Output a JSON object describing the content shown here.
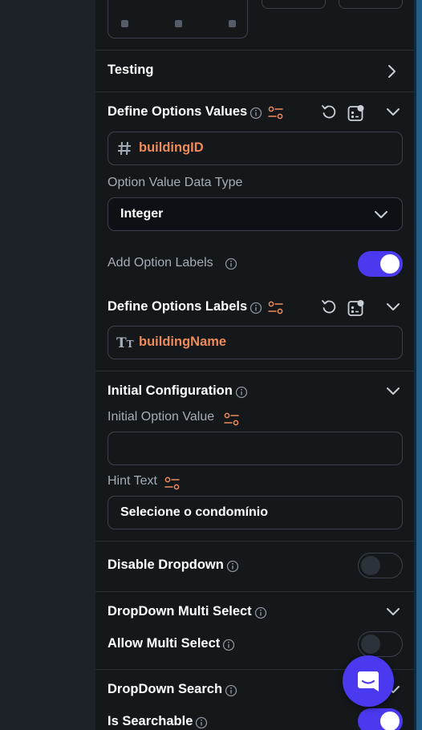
{
  "sections": {
    "testing": {
      "title": "Testing"
    },
    "define_values": {
      "title": "Define Options Values",
      "variable": "buildingID",
      "data_type_label": "Option Value Data Type",
      "data_type_value": "Integer",
      "add_labels_label": "Add Option Labels",
      "add_labels_on": true
    },
    "define_labels": {
      "title": "Define Options Labels",
      "variable": "buildingName"
    },
    "initial_config": {
      "title": "Initial Configuration",
      "initial_value_label": "Initial Option Value",
      "initial_value": "",
      "hint_label": "Hint Text",
      "hint_value": "Selecione o condomínio"
    },
    "disable_dropdown": {
      "title": "Disable Dropdown",
      "on": false
    },
    "multi_select": {
      "title": "DropDown Multi Select",
      "allow_label": "Allow Multi Select",
      "allow_on": false
    },
    "search": {
      "title": "DropDown Search",
      "searchable_label": "Is Searchable",
      "searchable_on": true
    }
  },
  "colors": {
    "accent": "#4b39ef",
    "variable": "#ee8b5b",
    "panel_bg": "#14181b",
    "field_border": "#39424c",
    "secondary_text": "#a4acb6"
  },
  "icons": [
    "chevron-right-icon",
    "chevron-down-icon",
    "info-icon",
    "variable-settings-icon",
    "undo-icon",
    "widget-state-icon",
    "hash-icon",
    "text-type-icon",
    "chat-icon"
  ]
}
